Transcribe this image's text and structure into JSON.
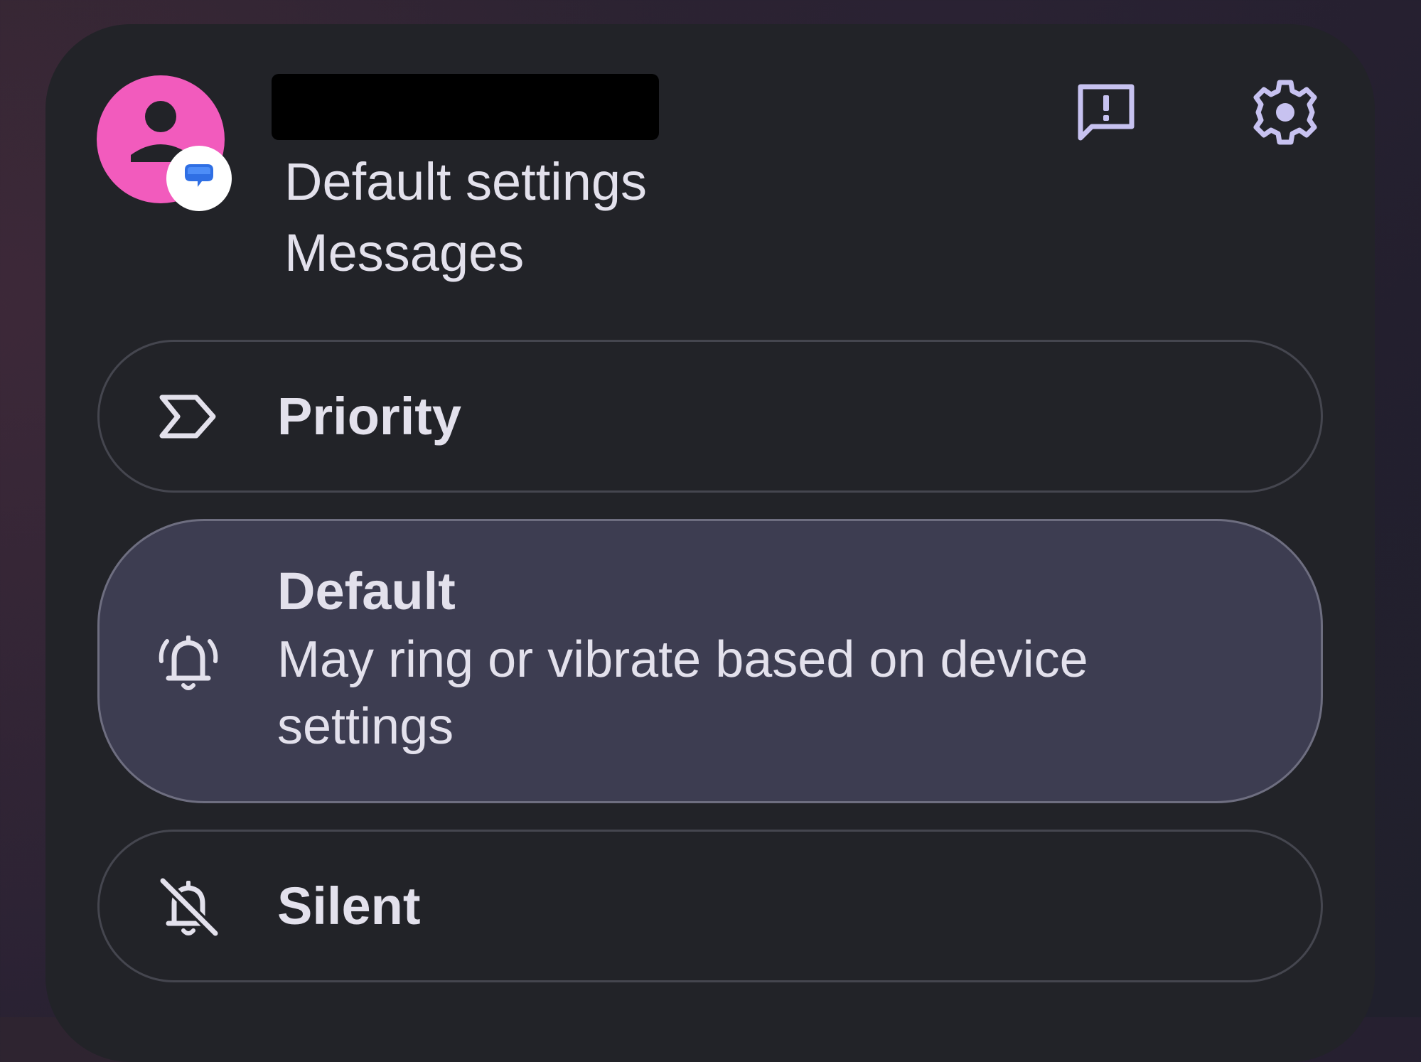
{
  "header": {
    "contact_name": "",
    "channel": "Default settings",
    "app_name": "Messages",
    "avatar_color": "#f25bbd",
    "feedback_icon": "feedback-icon",
    "settings_icon": "gear-icon"
  },
  "options": {
    "priority": {
      "label": "Priority",
      "icon": "priority-label-icon"
    },
    "default": {
      "label": "Default",
      "description": "May ring or vibrate based on device settings",
      "icon": "bell-ring-icon",
      "selected": true
    },
    "silent": {
      "label": "Silent",
      "icon": "bell-off-icon"
    }
  },
  "colors": {
    "panel_bg": "#222328",
    "selected_bg": "#3d3d51",
    "accent_icon": "#c7c2f0",
    "text": "#e3e1ec"
  }
}
